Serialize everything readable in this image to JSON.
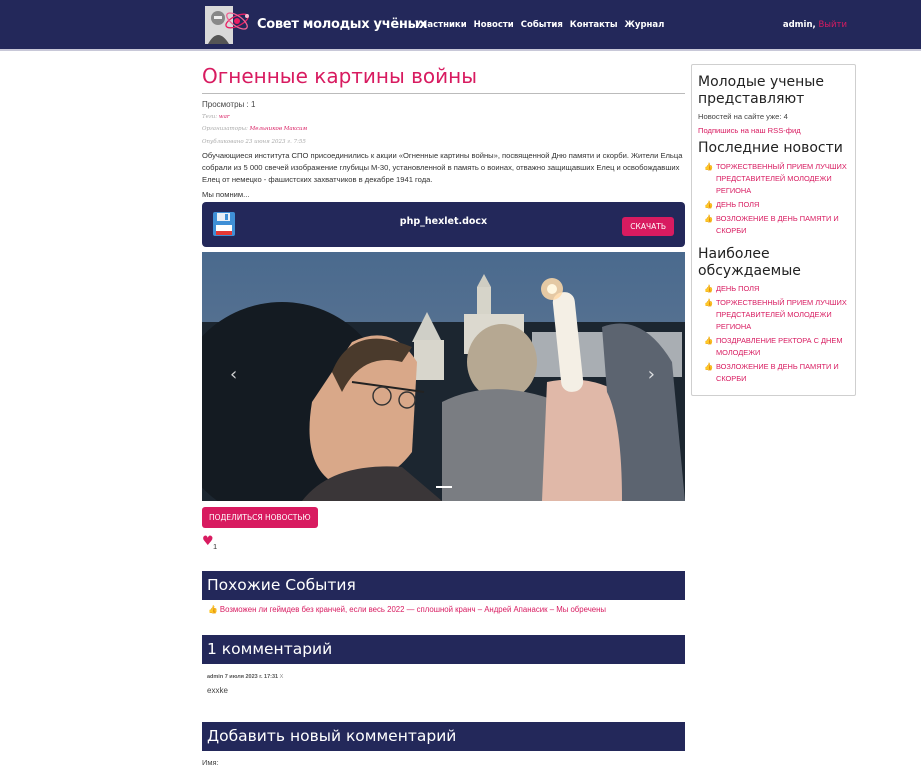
{
  "header": {
    "brand": "Совет молодых учёных",
    "nav": [
      "Участники",
      "Новости",
      "События",
      "Контакты",
      "Журнал"
    ],
    "user_name": "admin",
    "user_sep": ",",
    "logout": "Выйти"
  },
  "article": {
    "title": "Огненные картины войны",
    "views": "Просмотры : 1",
    "tags_label": "Теги:",
    "tags_value": "war",
    "organizers_label": "Организаторы:",
    "organizers_value": "Мельников Максим",
    "published": "Опубликовано 23 июня 2023 г. 7:55",
    "body": "Обучающиеся института СПО присоединились к акции «Огненные картины войны», посвященной Дню памяти и скорби. Жители Ельца собрали из 5 000 свечей изображение глубицы М-30, установленной в память о воинах, отважно защищавших Елец и освобождавших Елец от немецко - фашистских захватчиков в декабре 1941 года.",
    "more": "Мы помним...",
    "file_name": "php_hexlet.docx",
    "download": "СКАЧАТЬ",
    "share": "ПОДЕЛИТЬСЯ НОВОСТЬЮ",
    "likes": "1"
  },
  "similar": {
    "heading": "Похожие События",
    "items": [
      "Возможен ли геймдев без кранчей, если весь 2022 — сплошной кранч – Андрей Апанасик – Мы обречены"
    ]
  },
  "comments": {
    "heading": "1 комментарий",
    "items": [
      {
        "meta": "admin 7 июля 2023 г. 17:31",
        "delete": "X",
        "text": "exxke"
      }
    ]
  },
  "add_comment": {
    "heading": "Добавить новый комментарий",
    "name_label": "Имя:"
  },
  "sidebar": {
    "heading": "Молодые ученые представляют",
    "news_count": "Новостей на сайте уже: 4",
    "rss": "Подпишись на наш RSS-фид",
    "latest_heading": "Последние новости",
    "latest": [
      "ТОРЖЕСТВЕННЫЙ ПРИЕМ ЛУЧШИХ ПРЕДСТАВИТЕЛЕЙ МОЛОДЕЖИ РЕГИОНА",
      "ДЕНЬ ПОЛЯ",
      "ВОЗЛОЖЕНИЕ В ДЕНЬ ПАМЯТИ И СКОРБИ"
    ],
    "popular_heading": "Наиболее обсуждаемые",
    "popular": [
      "ДЕНЬ ПОЛЯ",
      "ТОРЖЕСТВЕННЫЙ ПРИЕМ ЛУЧШИХ ПРЕДСТАВИТЕЛЕЙ МОЛОДЕЖИ РЕГИОНА",
      "ПОЗДРАВЛЕНИЕ РЕКТОРА С ДНЕМ МОЛОДЕЖИ",
      "ВОЗЛОЖЕНИЕ В ДЕНЬ ПАМЯТИ И СКОРБИ"
    ]
  },
  "colors": {
    "navy": "#23285a",
    "accent": "#d81b60"
  }
}
